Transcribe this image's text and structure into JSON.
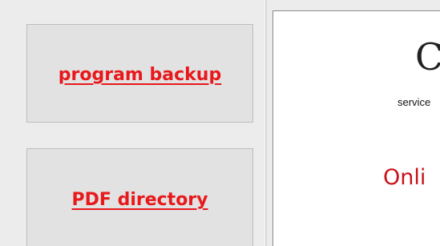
{
  "sidebar": {
    "buttons": [
      {
        "label": "program backup"
      },
      {
        "label": "PDF directory"
      }
    ]
  },
  "content": {
    "title_fragment": "C",
    "subtitle_fragment": "service",
    "online_fragment": "Onli"
  },
  "colors": {
    "link_red": "#e8181b",
    "online_red": "#c8121b",
    "panel_bg": "#ececec",
    "button_bg": "#e2e2e2"
  }
}
